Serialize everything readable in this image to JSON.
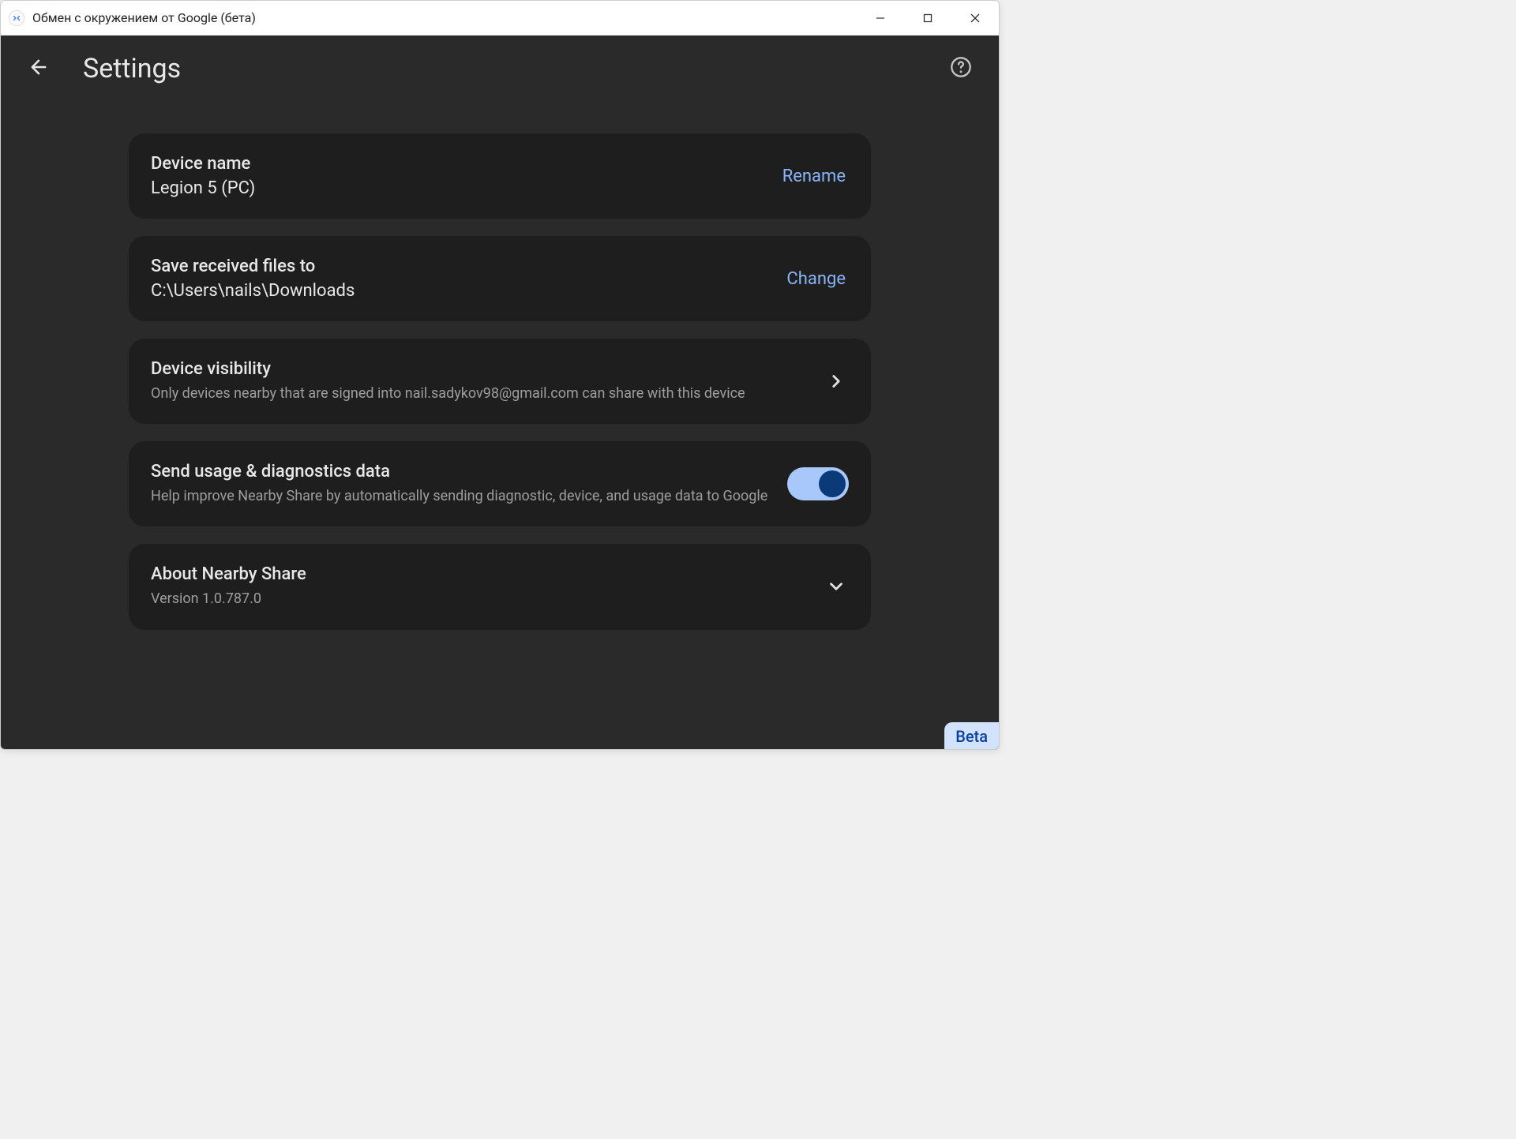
{
  "window": {
    "title": "Обмен с окружением от Google (бета)"
  },
  "header": {
    "page_title": "Settings"
  },
  "cards": {
    "device_name": {
      "label": "Device name",
      "value": "Legion 5 (PC)",
      "action": "Rename"
    },
    "save_path": {
      "label": "Save received files to",
      "value": "C:\\Users\\nails\\Downloads",
      "action": "Change"
    },
    "visibility": {
      "label": "Device visibility",
      "desc": "Only devices nearby that are signed into nail.sadykov98@gmail.com can share with this device"
    },
    "diagnostics": {
      "label": "Send usage & diagnostics data",
      "desc": "Help improve Nearby Share by automatically sending diagnostic, device, and usage data to Google",
      "enabled": true
    },
    "about": {
      "label": "About Nearby Share",
      "version": "Version 1.0.787.0"
    }
  },
  "badge": "Beta"
}
